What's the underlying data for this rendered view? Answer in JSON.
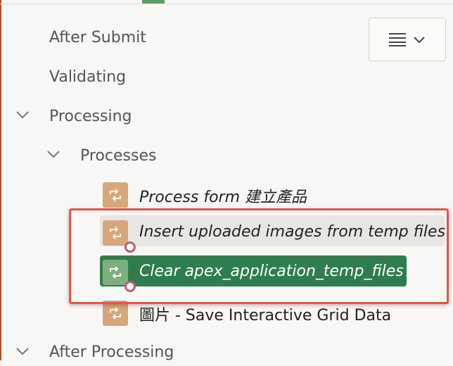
{
  "tree": {
    "after_submit": "After Submit",
    "validating": "Validating",
    "processing": "Processing",
    "processes": "Processes",
    "after_processing": "After Processing",
    "items": [
      "Process form 建立產品",
      "Insert uploaded images from temp files",
      "Clear apex_application_temp_files",
      "圖片 - Save Interactive Grid Data"
    ]
  },
  "toolbar": {
    "menu_icon": "hamburger-menu-icon",
    "dropdown_icon": "chevron-down-icon"
  },
  "colors": {
    "selected_bg": "#e8e6e3",
    "current_bg": "#2f7d4e",
    "annotation_border": "#e5534b",
    "process_icon": "#d7a77c"
  }
}
